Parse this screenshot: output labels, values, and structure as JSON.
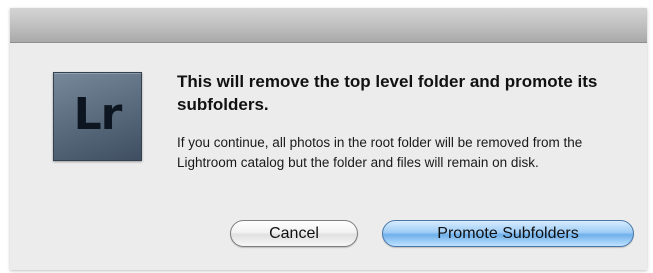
{
  "dialog": {
    "app_icon_text": "Lr",
    "heading": "This will remove the top level folder and promote its subfolders.",
    "message": "If you continue, all photos in the root folder will be removed from the Lightroom catalog but the folder and files will remain on disk.",
    "buttons": {
      "cancel_label": "Cancel",
      "default_label": "Promote Subfolders"
    }
  },
  "colors": {
    "dialog_background": "#ececec",
    "default_button_accent": "#6fb0ea",
    "app_icon_background": "#5c6e80"
  },
  "icons": {
    "app_icon": "lightroom-app-icon"
  }
}
